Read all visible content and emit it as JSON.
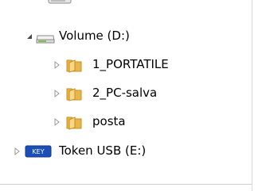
{
  "tree": {
    "partial_item": {
      "label": ""
    },
    "items": [
      {
        "label": "Volume (D:)",
        "expanded": true,
        "icon": "drive-icon",
        "level": 1
      },
      {
        "label": "1_PORTATILE",
        "expanded": false,
        "icon": "folder-icon",
        "level": 2
      },
      {
        "label": "2_PC-salva",
        "expanded": false,
        "icon": "folder-icon",
        "level": 2
      },
      {
        "label": "posta",
        "expanded": false,
        "icon": "folder-icon",
        "level": 2
      },
      {
        "label": "Token USB (E:)",
        "expanded": false,
        "icon": "usb-key-icon",
        "level": 1,
        "badge": "KEY"
      }
    ]
  },
  "colors": {
    "folder": "#e8b64a",
    "folder_dark": "#c98f1f",
    "usb_badge": "#1b4fb7",
    "arrow": "#9a9a9a",
    "arrow_expanded": "#4a4a4a"
  }
}
